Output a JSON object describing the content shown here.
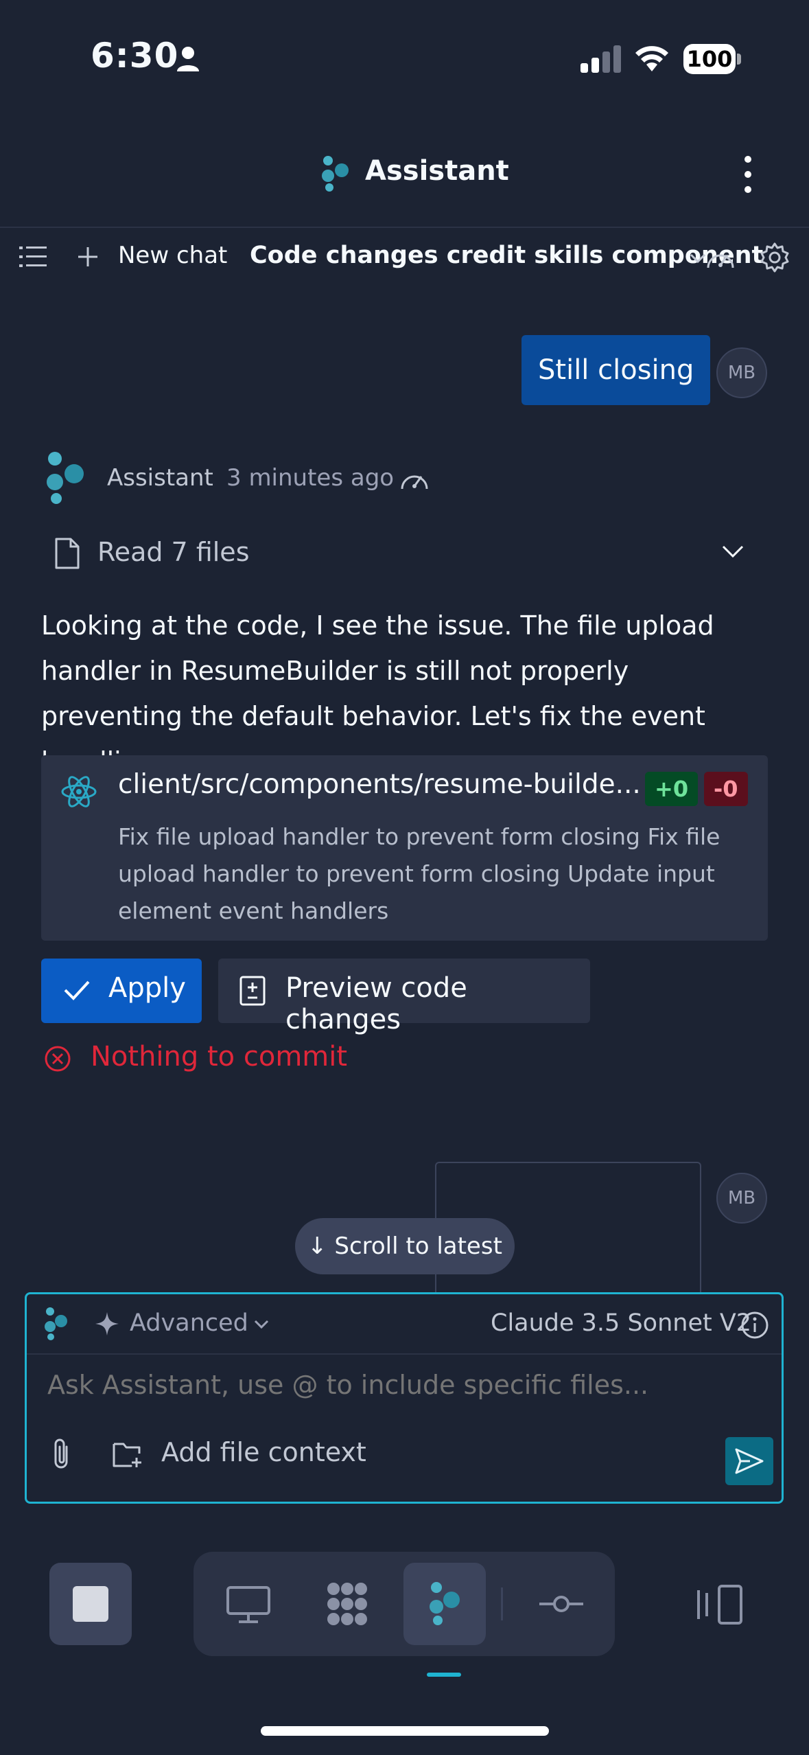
{
  "status_bar": {
    "time": "6:30",
    "battery": "100"
  },
  "header": {
    "title": "Assistant"
  },
  "toolbar": {
    "new_chat": "New chat",
    "chat_title": "Code changes credit skills component"
  },
  "user_message": {
    "text": "Still closing",
    "avatar": "MB"
  },
  "assistant_meta": {
    "name": "Assistant",
    "time": "3 minutes ago"
  },
  "read_files": {
    "label": "Read 7 files"
  },
  "message": {
    "body": "Looking at the code, I see the issue. The file upload handler in ResumeBuilder is still not properly preventing the default behavior. Let's fix the event handling:"
  },
  "code_change": {
    "file_path": "client/src/components/resume-builde...",
    "additions": "+0",
    "deletions": "-0",
    "description": "Fix file upload handler to prevent form closing Fix file upload handler to prevent form closing Update input element event handlers"
  },
  "actions": {
    "apply": "Apply",
    "preview": "Preview code changes"
  },
  "error": {
    "text": "Nothing to commit"
  },
  "second_avatar": "MB",
  "scroll_pill": "↓ Scroll to latest",
  "composer": {
    "mode": "Advanced",
    "model": "Claude 3.5 Sonnet V2",
    "placeholder": "Ask Assistant, use @ to include specific files...",
    "add_context": "Add file context"
  },
  "colors": {
    "background": "#1c2333",
    "surface": "#2b3245",
    "accent_blue": "#0b5cc4",
    "accent_cyan": "#1fb3d1",
    "error_red": "#e0273a"
  },
  "icons": [
    "person-icon",
    "signal-icon",
    "wifi-icon",
    "battery-icon",
    "assistant-logo-icon",
    "kebab-menu-icon",
    "menu-list-icon",
    "plus-icon",
    "chevron-down-icon",
    "gauge-icon",
    "gear-icon",
    "file-icon",
    "react-icon",
    "check-icon",
    "diff-file-icon",
    "error-circle-icon",
    "sparkle-icon",
    "info-icon",
    "paperclip-icon",
    "folder-plus-icon",
    "send-icon",
    "stop-icon",
    "monitor-icon",
    "grid-icon",
    "commit-icon",
    "panels-icon"
  ]
}
